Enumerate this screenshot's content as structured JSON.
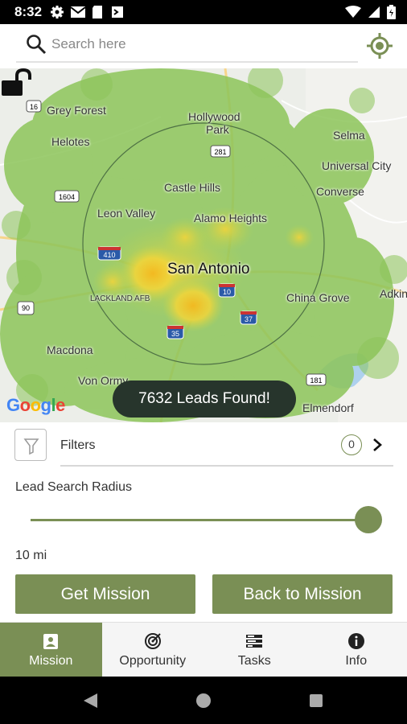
{
  "status_bar": {
    "time": "8:32",
    "left_icons": [
      "gear-icon",
      "mail-icon",
      "sim-icon",
      "app-icon"
    ],
    "right_icons": [
      "wifi-icon",
      "signal-icon",
      "battery-icon"
    ]
  },
  "search": {
    "placeholder": "Search here",
    "value": ""
  },
  "map": {
    "place_labels": {
      "grey_forest": "Grey Forest",
      "helotes": "Helotes",
      "hollywood_park": "Hollywood",
      "hollywood_park_2": "Park",
      "selma": "Selma",
      "universal_city": "Universal City",
      "converse": "Converse",
      "castle_hills": "Castle Hills",
      "leon_valley": "Leon Valley",
      "alamo_heights": "Alamo Heights",
      "san_antonio": "San Antonio",
      "lackland": "LACKLAND AFB",
      "china_grove": "China Grove",
      "adkins": "Adkin",
      "macdona": "Macdona",
      "von_ormy": "Von Ormy",
      "elmendorf": "Elmendorf"
    },
    "road_shields": {
      "r16": "16",
      "r281": "281",
      "r1604": "1604",
      "r410": "410",
      "r10": "10",
      "r90": "90",
      "r37": "37",
      "r35": "35",
      "r181": "181"
    },
    "leads_found": "7632 Leads Found!",
    "attribution": "Google",
    "lock_state": "unlocked",
    "colors": {
      "heat_green": "#8dc55a",
      "heat_yellow": "#f2d53a",
      "heat_orange": "#f5b81e"
    }
  },
  "filters": {
    "label": "Filters",
    "count": "0"
  },
  "radius": {
    "label": "Lead Search Radius",
    "value_text": "10 mi",
    "slider_fraction": 1.0
  },
  "buttons": {
    "get_mission": "Get Mission",
    "back_to_mission": "Back to Mission"
  },
  "bottom_nav": {
    "items": [
      {
        "label": "Mission",
        "icon": "badge-icon",
        "active": true
      },
      {
        "label": "Opportunity",
        "icon": "target-icon",
        "active": false
      },
      {
        "label": "Tasks",
        "icon": "tasks-icon",
        "active": false
      },
      {
        "label": "Info",
        "icon": "info-icon",
        "active": false
      }
    ]
  },
  "theme": {
    "accent": "#7a8f55",
    "pill_bg": "#27352c"
  }
}
